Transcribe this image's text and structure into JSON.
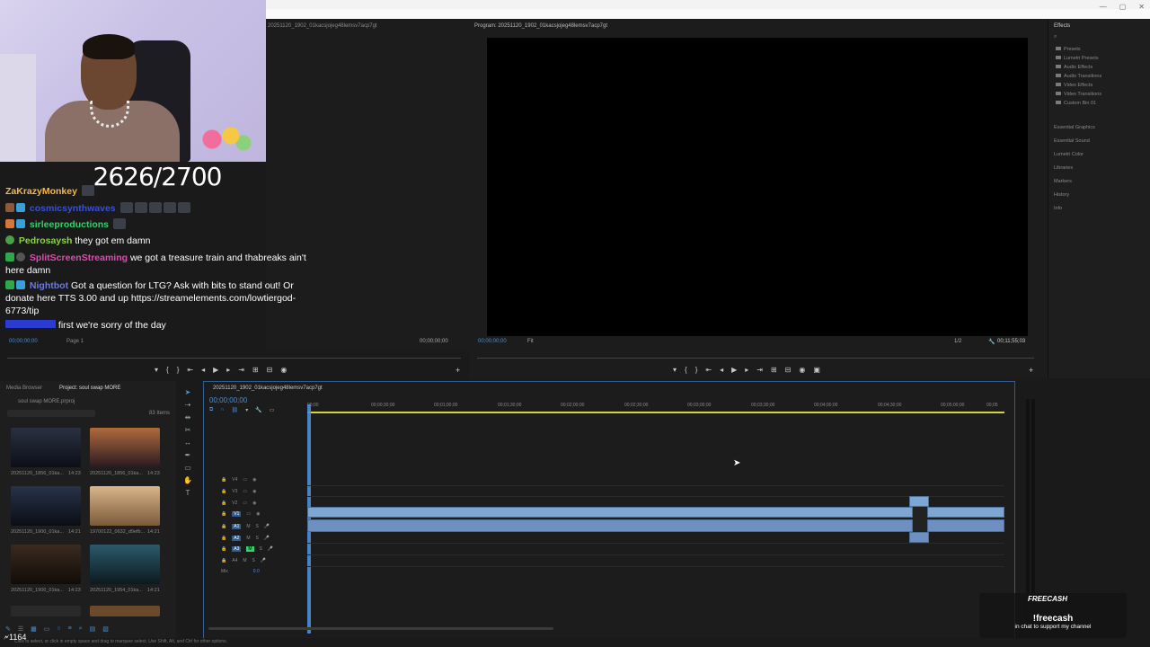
{
  "window": {
    "controls": [
      "—",
      "▢",
      "✕"
    ]
  },
  "stream": {
    "counter": "2626/2700",
    "viewers": "1164"
  },
  "chat": [
    {
      "user": "ZaKrazyMonkey",
      "color": "#f5b94a",
      "text": ""
    },
    {
      "user": "cosmicsynthwaves",
      "color": "#3a4fd1",
      "text": ""
    },
    {
      "user": "sirleeproductions",
      "color": "#33d16b",
      "text": ""
    },
    {
      "user": "Pedrosaysh",
      "color": "#8bd14a",
      "text": "they got em damn"
    },
    {
      "user": "SplitScreenStreaming",
      "color": "#e24ab0",
      "text": "we got a treasure train and thabreaks ain't here damn"
    },
    {
      "user": "Nightbot",
      "color": "#6a7bd8",
      "text": "Got a question for LTG? Ask with bits to stand out! Or donate here TTS 3.00 and up https://streamelements.com/lowtiergod-6773/tip"
    },
    {
      "user": "",
      "color": "#2a3bd1",
      "text": "first we're sorry of the day"
    }
  ],
  "source": {
    "tab": "20251120_1902_01kacsjojeg48lemsv7acp7gt",
    "timecode_left": "00;00;00;00",
    "page": "Page 1",
    "timecode_right": "00;00;00;00"
  },
  "program": {
    "title": "Program: 20251120_1902_01kacsjojeg48lemsv7acp7gt",
    "timecode": "00;00;00;00",
    "fit": "Fit",
    "ratio": "1/2",
    "duration": "00;11;55;03"
  },
  "effects": {
    "title": "Effects",
    "folders": [
      "Presets",
      "Lumetri Presets",
      "Audio Effects",
      "Audio Transitions",
      "Video Effects",
      "Video Transitions",
      "Custom Bin 01"
    ],
    "panels": [
      "Essential Graphics",
      "Essential Sound",
      "Lumetri Color",
      "Libraries",
      "Markers",
      "History",
      "Info"
    ]
  },
  "project": {
    "tab_media": "Media Browser",
    "tab_project": "Project: soul swap MORE",
    "file": "soul swap MORE.prproj",
    "items_count": "83 Items",
    "thumbs": [
      {
        "label": "20251120_1856_01ka...",
        "dur": "14:23",
        "c1": "#2a3040",
        "c2": "#0c0f18"
      },
      {
        "label": "20251120_1856_01ka...",
        "dur": "14:23",
        "c1": "#b06a3c",
        "c2": "#2a1a20"
      },
      {
        "label": "20251120_1900_01ka...",
        "dur": "14:21",
        "c1": "#27324a",
        "c2": "#0b0e15"
      },
      {
        "label": "19700122_0632_d9efb...",
        "dur": "14:21",
        "c1": "#d9b58a",
        "c2": "#7a5a3a"
      },
      {
        "label": "20251120_1900_01ka...",
        "dur": "14:23",
        "c1": "#3a2a20",
        "c2": "#120c08"
      },
      {
        "label": "20251120_1954_01ka...",
        "dur": "14:21",
        "c1": "#2a5a6a",
        "c2": "#0d1a20"
      }
    ]
  },
  "timeline": {
    "tab": "20251120_1902_01kacsjojeg48lemsv7acp7gt",
    "timecode": "00;00;00;00",
    "ticks": [
      "00;00",
      "00;00;30;00",
      "00;01;00;00",
      "00;01;30;00",
      "00;02;00;00",
      "00;02;30;00",
      "00;03;00;00",
      "00;03;30;00",
      "00;04;00;00",
      "00;04;30;00",
      "00;05;00;00",
      "00;05"
    ],
    "video_tracks": [
      "V4",
      "V3",
      "V2",
      "V1"
    ],
    "audio_tracks": [
      "A1",
      "A2",
      "A3",
      "A4"
    ],
    "mix": "Mix",
    "mix_value": "0.0"
  },
  "overlay": {
    "brand": "FREECASH",
    "command": "!freecash",
    "subtext": "in chat to support my channel"
  },
  "status": "Click to select, or click in empty space and drag to marquee select. Use Shift, Alt, and Ctrl for other options."
}
